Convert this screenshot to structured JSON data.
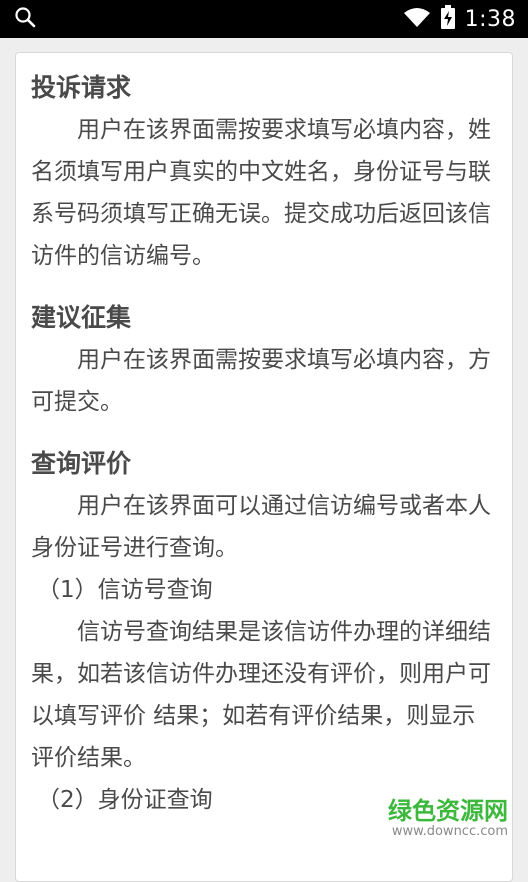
{
  "status_bar": {
    "time": "1:38",
    "icons": [
      "search-icon",
      "wifi-icon",
      "battery-charging-icon"
    ]
  },
  "sections": [
    {
      "title": "投诉请求",
      "paragraphs": [
        "用户在该界面需按要求填写必填内容，姓名须填写用户真实的中文姓名，身份证号与联系号码须填写正确无误。提交成功后返回该信访件的信访编号。"
      ]
    },
    {
      "title": "建议征集",
      "paragraphs": [
        "用户在该界面需按要求填写必填内容，方可提交。"
      ]
    },
    {
      "title": "查询评价",
      "paragraphs": [
        "用户在该界面可以通过信访编号或者本人身份证号进行查询。"
      ],
      "sub_items": [
        {
          "label": "（1）信访号查询",
          "text": "信访号查询结果是该信访件办理的详细结果，如若该信访件办理还没有评价，则用户可以填写评价 结果；如若有评价结果，则显示评价结果。"
        },
        {
          "label": "（2）身份证查询"
        }
      ]
    }
  ],
  "watermark": {
    "main": "绿色资源网",
    "sub": "www.downcc.com"
  },
  "colors": {
    "status_bar_bg": "#000000",
    "page_bg": "#eeeeee",
    "card_bg": "#ffffff",
    "text": "#4a4a4a",
    "watermark_green": "#3db83d"
  }
}
